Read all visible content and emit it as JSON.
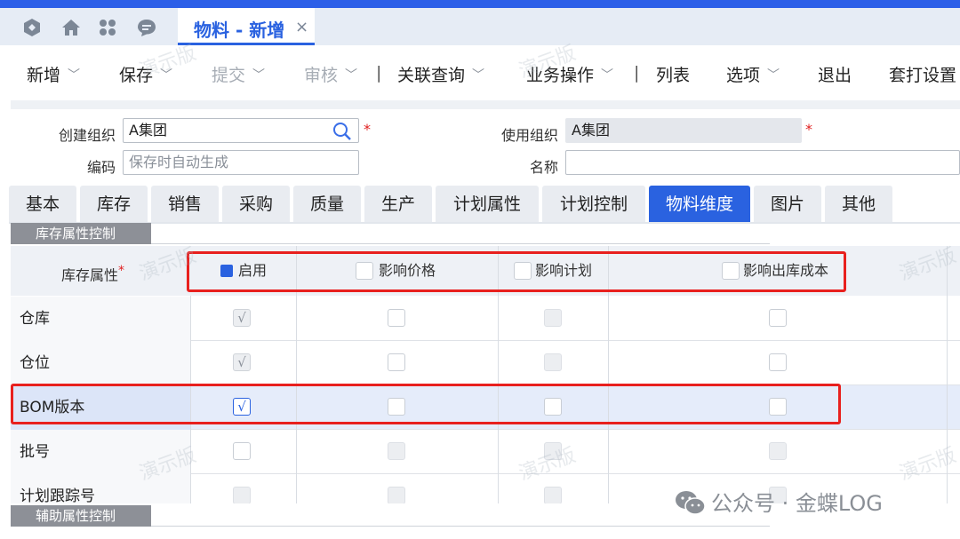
{
  "nav": {
    "icons": [
      "logo-icon",
      "home-icon",
      "apps-icon",
      "message-icon"
    ],
    "tab_title": "物料 - 新增",
    "tab_close": "×"
  },
  "toolbar": {
    "items": [
      {
        "label": "新增",
        "dropdown": true,
        "disabled": false
      },
      {
        "label": "保存",
        "dropdown": true,
        "disabled": false
      },
      {
        "label": "提交",
        "dropdown": true,
        "disabled": true
      },
      {
        "label": "审核",
        "dropdown": true,
        "disabled": true
      },
      {
        "label": "关联查询",
        "dropdown": true,
        "disabled": false
      },
      {
        "label": "业务操作",
        "dropdown": true,
        "disabled": false
      },
      {
        "label": "列表",
        "dropdown": false,
        "disabled": false
      },
      {
        "label": "选项",
        "dropdown": true,
        "disabled": false
      },
      {
        "label": "退出",
        "dropdown": false,
        "disabled": false
      },
      {
        "label": "套打设置",
        "dropdown": false,
        "disabled": false
      }
    ],
    "separator": "|",
    "arrow": "﹀"
  },
  "form": {
    "create_org_label": "创建组织",
    "create_org_value": "A集团",
    "use_org_label": "使用组织",
    "use_org_value": "A集团",
    "code_label": "编码",
    "code_placeholder": "保存时自动生成",
    "name_label": "名称",
    "name_value": "",
    "required_mark": "*"
  },
  "tabs": [
    "基本",
    "库存",
    "销售",
    "采购",
    "质量",
    "生产",
    "计划属性",
    "计划控制",
    "物料维度",
    "图片",
    "其他"
  ],
  "active_tab": "物料维度",
  "sections": {
    "inventory_control": "库存属性控制",
    "aux_control": "辅助属性控制"
  },
  "grid": {
    "header_label": "库存属性",
    "header_required": "*",
    "columns": [
      "启用",
      "影响价格",
      "影响计划",
      "影响出库成本"
    ],
    "check_mark": "√",
    "rows": [
      {
        "label": "仓库",
        "enabled": "checked-disabled",
        "price": "empty",
        "plan": "disabled",
        "cost": "empty"
      },
      {
        "label": "仓位",
        "enabled": "checked-disabled",
        "price": "empty",
        "plan": "disabled",
        "cost": "empty"
      },
      {
        "label": "BOM版本",
        "enabled": "checked",
        "price": "empty",
        "plan": "empty",
        "cost": "empty",
        "selected": true
      },
      {
        "label": "批号",
        "enabled": "empty",
        "price": "disabled",
        "plan": "disabled",
        "cost": "disabled"
      },
      {
        "label": "计划跟踪号",
        "enabled": "disabled",
        "price": "disabled",
        "plan": "disabled",
        "cost": "disabled"
      }
    ]
  },
  "watermark_text": "演示版",
  "footer_text": "公众号 · 金蝶LOG",
  "colors": {
    "accent": "#2a62e0",
    "highlight": "#e8201e"
  }
}
